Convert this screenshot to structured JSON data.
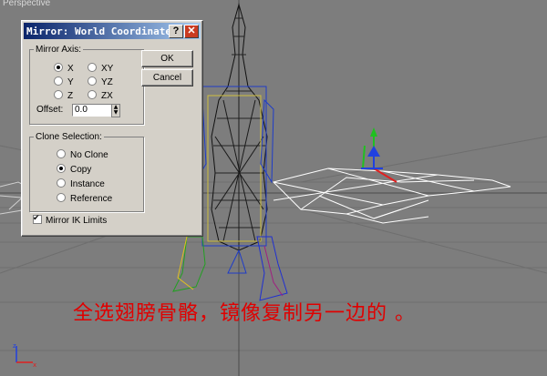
{
  "viewport": {
    "label": "Perspective",
    "caption": "全选翅膀骨骼，镜像复制另一边的 。",
    "gizmo_colors": {
      "x": "#e02020",
      "y": "#20c020",
      "z": "#2040e0"
    }
  },
  "dialog": {
    "title": "Mirror: World Coordinates",
    "help_glyph": "?",
    "close_glyph": "✕",
    "mirror_axis": {
      "legend": "Mirror Axis:",
      "options": [
        "X",
        "Y",
        "Z",
        "XY",
        "YZ",
        "ZX"
      ],
      "selected": "X",
      "offset_label": "Offset:",
      "offset_value": "0.0"
    },
    "clone_selection": {
      "legend": "Clone Selection:",
      "options": [
        "No Clone",
        "Copy",
        "Instance",
        "Reference"
      ],
      "selected": "Copy"
    },
    "mirror_ik": {
      "label": "Mirror IK Limits",
      "checked": true
    },
    "ok_label": "OK",
    "cancel_label": "Cancel"
  }
}
